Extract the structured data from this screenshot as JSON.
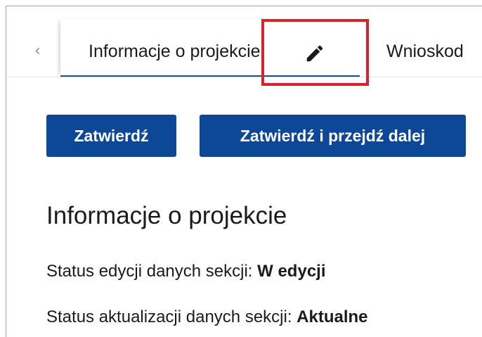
{
  "tabs": {
    "prev_symbol": "‹",
    "active_label": "Informacje o projekcie",
    "next_label": "Wnioskod"
  },
  "toolbar": {
    "confirm_label": "Zatwierdź",
    "confirm_next_label": "Zatwierdź i przejdź dalej"
  },
  "section": {
    "title": "Informacje o projekcie",
    "edit_status_label": "Status edycji danych sekcji: ",
    "edit_status_value": "W edycji",
    "update_status_label": "Status aktualizacji danych sekcji: ",
    "update_status_value": "Aktualne"
  },
  "icons": {
    "edit": "pencil-icon",
    "prev": "chevron-left-icon"
  },
  "colors": {
    "primary_button": "#0d4797",
    "active_tab_underline": "#1d4e9a",
    "highlight": "#d8232f"
  }
}
